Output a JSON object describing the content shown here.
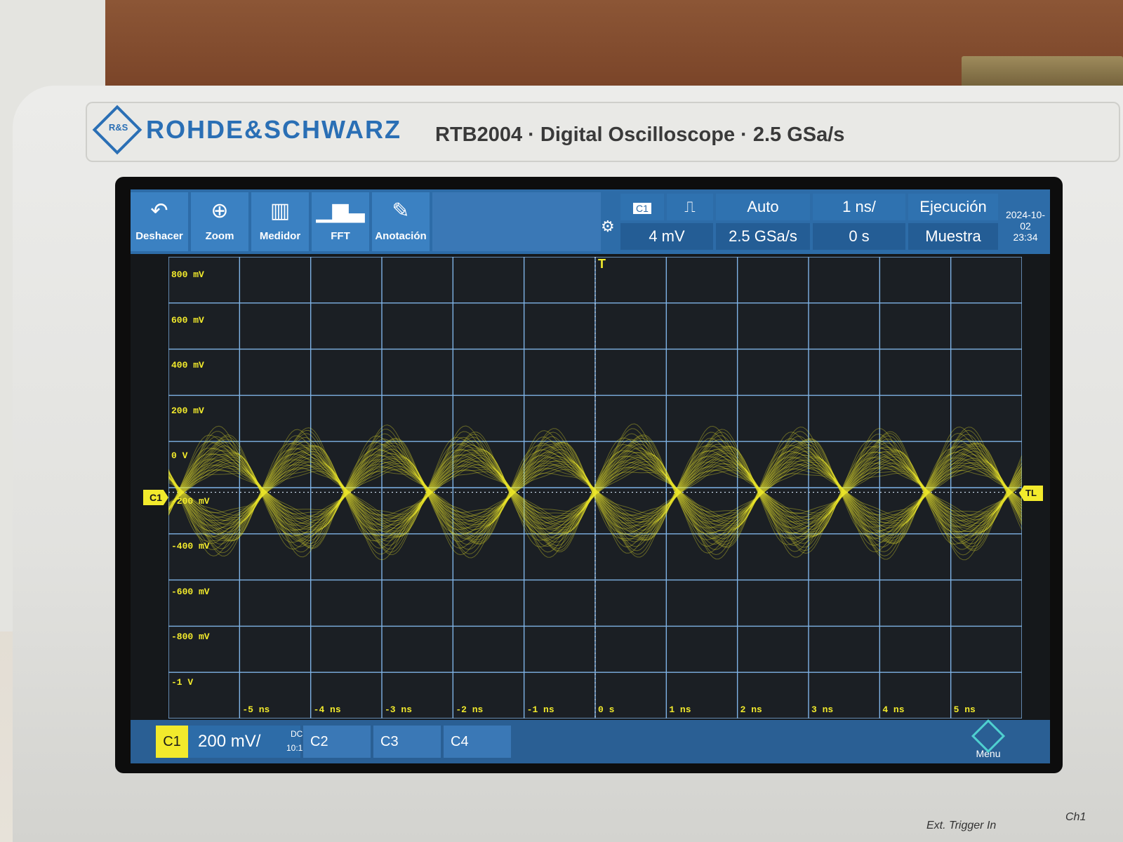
{
  "brand": {
    "logo_text": "R&S",
    "name": "ROHDE&SCHWARZ",
    "model_line": "RTB2004 · Digital Oscilloscope · 2.5 GSa/s"
  },
  "toolbar": {
    "undo": "Deshacer",
    "zoom": "Zoom",
    "meter": "Medidor",
    "fft": "FFT",
    "annotation": "Anotación"
  },
  "status": {
    "channel": "C1",
    "trigger_level": "4 mV",
    "trigger_mode": "Auto",
    "sample_rate": "2.5 GSa/s",
    "timebase": "1 ns/",
    "position": "0 s",
    "run_state": "Ejecución",
    "acq_mode": "Muestra",
    "date": "2024-10-02",
    "time": "23:34"
  },
  "y_labels": [
    "800 mV",
    "600 mV",
    "400 mV",
    "200 mV",
    "0 V",
    "-200 mV",
    "-400 mV",
    "-600 mV",
    "-800 mV",
    "-1 V"
  ],
  "x_labels": [
    "-5 ns",
    "-4 ns",
    "-3 ns",
    "-2 ns",
    "-1 ns",
    "0 s",
    "1 ns",
    "2 ns",
    "3 ns",
    "4 ns",
    "5 ns"
  ],
  "markers": {
    "c1": "C1",
    "trigger_level": "TL",
    "trigger_pos": "T"
  },
  "channels": {
    "c1_label": "C1",
    "c1_scale": "200 mV/",
    "c1_coupling": "DC",
    "c1_probe": "10:1",
    "c2": "C2",
    "c3": "C3",
    "c4": "C4",
    "menu": "Menu"
  },
  "front_panel": {
    "ext_trigger": "Ext. Trigger In",
    "ch1": "Ch1"
  },
  "colors": {
    "trace": "#f2ea2c",
    "ui_blue": "#2d6ca8",
    "grid": "#7fb3e6"
  },
  "chart_data": {
    "type": "line",
    "x_unit": "ns",
    "y_unit": "mV",
    "xlim": [
      -6,
      6
    ],
    "ylim": [
      -1000,
      1000
    ],
    "volts_per_div": 200,
    "time_per_div_ns": 1,
    "envelope_amplitude_mV": 300,
    "envelope_period_ns": 2.33,
    "description_values": {
      "peak_mV": 300,
      "trough_mV": -300
    }
  }
}
